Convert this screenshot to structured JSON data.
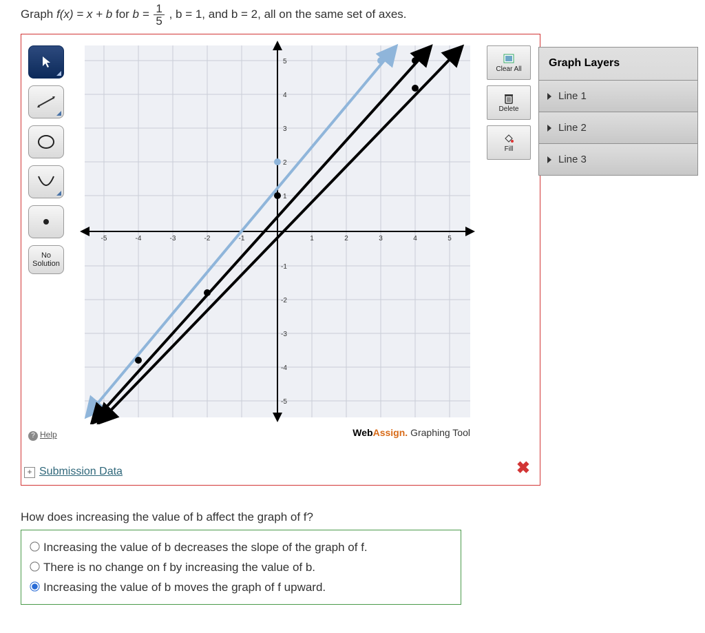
{
  "prompt": {
    "prefix": "Graph ",
    "fx": "f(x) = x + b",
    "for": " for ",
    "beq": "b = ",
    "frac_num": "1",
    "frac_den": "5",
    "mid": ", b = 1, and b = 2, all on the same set of axes."
  },
  "tools": {
    "pointer": "pointer",
    "line": "line",
    "circle": "circle",
    "parabola": "parabola",
    "point": "point",
    "nosol_l1": "No",
    "nosol_l2": "Solution",
    "help": "Help"
  },
  "right_buttons": {
    "clear": "Clear All",
    "delete": "Delete",
    "fill": "Fill"
  },
  "layers": {
    "title": "Graph Layers",
    "items": [
      "Line 1",
      "Line 2",
      "Line 3"
    ]
  },
  "grid": {
    "xmin": -5,
    "xmax": 5,
    "ymin": -5,
    "ymax": 5,
    "ticks": [
      -5,
      -4,
      -3,
      -2,
      -1,
      1,
      2,
      3,
      4,
      5
    ]
  },
  "chart_data": {
    "type": "line",
    "xlabel": "",
    "ylabel": "",
    "xlim": [
      -5.5,
      5.5
    ],
    "ylim": [
      -5.5,
      5.5
    ],
    "series": [
      {
        "name": "b = 2",
        "intercept": 2,
        "slope": 1,
        "points": [
          [
            -5,
            -3
          ],
          [
            0,
            2
          ],
          [
            3,
            5
          ]
        ],
        "color": "#8fb5da"
      },
      {
        "name": "b = 1",
        "intercept": 1,
        "slope": 1,
        "points": [
          [
            -5,
            -4
          ],
          [
            0,
            1
          ],
          [
            4,
            5
          ]
        ],
        "color": "#000000"
      },
      {
        "name": "b = 1/5",
        "intercept": 0.2,
        "slope": 1,
        "points": [
          [
            -5,
            -4.8
          ],
          [
            0,
            0.2
          ],
          [
            4.8,
            5
          ]
        ],
        "color": "#000000"
      }
    ]
  },
  "brand": {
    "a": "Web",
    "b": "Assign.",
    "c": " Graphing Tool"
  },
  "submission": "Submission Data",
  "status": "incorrect",
  "question": "How does increasing the value of b affect the graph of f?",
  "options": [
    "Increasing the value of b decreases the slope of the graph of f.",
    "There is no change on f by increasing the value of b.",
    "Increasing the value of b moves the graph of f upward."
  ],
  "selected_index": 2
}
